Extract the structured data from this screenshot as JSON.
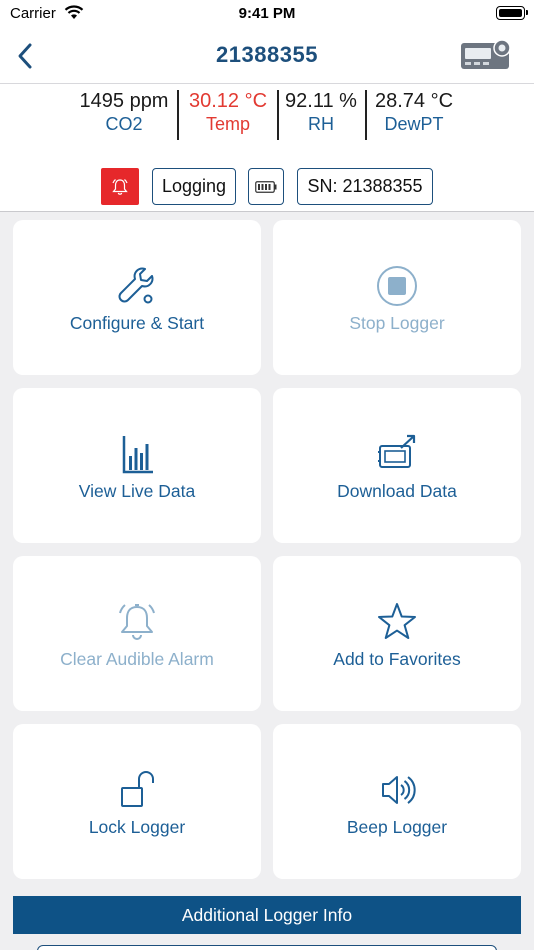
{
  "status_bar": {
    "carrier": "Carrier",
    "time": "9:41 PM"
  },
  "nav": {
    "title": "21388355"
  },
  "readings": [
    {
      "value": "1495 ppm",
      "label": "CO2",
      "alert": false
    },
    {
      "value": "30.12 °C",
      "label": "Temp",
      "alert": true
    },
    {
      "value": "92.11 %",
      "label": "RH",
      "alert": false
    },
    {
      "value": "28.74 °C",
      "label": "DewPT",
      "alert": false
    }
  ],
  "badges": {
    "status": "Logging",
    "serial": "SN: 21388355"
  },
  "tiles": [
    {
      "label": "Configure & Start",
      "icon": "wrench-icon",
      "enabled": true
    },
    {
      "label": "Stop Logger",
      "icon": "stop-icon",
      "enabled": false
    },
    {
      "label": "View Live Data",
      "icon": "bar-chart-icon",
      "enabled": true
    },
    {
      "label": "Download Data",
      "icon": "download-device-icon",
      "enabled": true
    },
    {
      "label": "Clear Audible Alarm",
      "icon": "bell-icon",
      "enabled": false
    },
    {
      "label": "Add to Favorites",
      "icon": "star-icon",
      "enabled": true
    },
    {
      "label": "Lock Logger",
      "icon": "unlock-icon",
      "enabled": true
    },
    {
      "label": "Beep Logger",
      "icon": "speaker-icon",
      "enabled": true
    }
  ],
  "footer": {
    "additional_info": "Additional Logger Info"
  },
  "colors": {
    "brand": "#1d4f7c",
    "accent": "#1d5f96",
    "alert": "#e23a32",
    "footer_bg": "#0e5286",
    "disabled": "#8db0cb"
  }
}
